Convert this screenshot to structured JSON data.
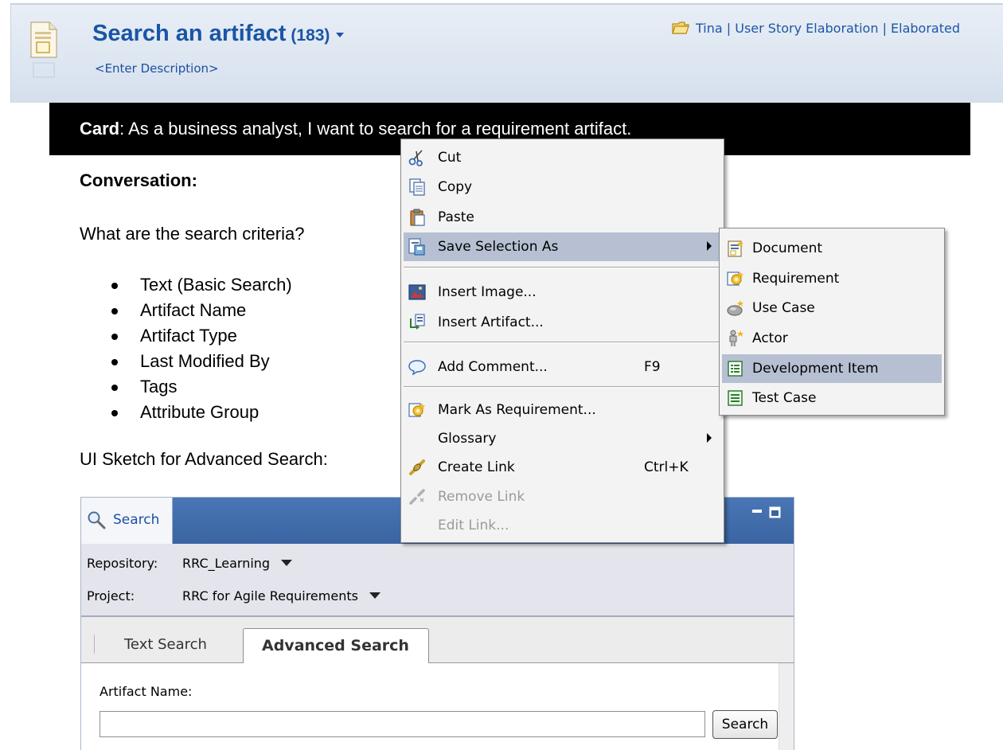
{
  "header": {
    "title": "Search an artifact",
    "count": "(183)",
    "description": "<Enter Description>",
    "context": "Tina | User Story Elaboration | Elaborated"
  },
  "card": {
    "label": "Card",
    "text": ": As a business analyst, I want to search for a requirement artifact."
  },
  "conversation": {
    "heading": "Conversation:",
    "question": "What are the search criteria?",
    "bullets": [
      "Text (Basic Search)",
      "Artifact Name",
      "Artifact Type",
      "Last Modified By",
      "Tags",
      "Attribute Group"
    ],
    "sketch_label": "UI Sketch for Advanced Search:"
  },
  "search_panel": {
    "tab_label": "Search",
    "repository_label": "Repository:",
    "repository_value": "RRC_Learning",
    "project_label": "Project:",
    "project_value": "RRC for Agile Requirements",
    "tabs": [
      "Text Search",
      "Advanced Search"
    ],
    "active_tab": "Advanced Search",
    "field_label": "Artifact Name:",
    "field_value": "",
    "search_button": "Search"
  },
  "context_menu": {
    "items": [
      {
        "label": "Cut",
        "icon": "scissors-icon"
      },
      {
        "label": "Copy",
        "icon": "copy-icon"
      },
      {
        "label": "Paste",
        "icon": "paste-icon"
      },
      {
        "label": "Save Selection As",
        "icon": "save-selection-icon",
        "submenu": true,
        "highlighted": true
      },
      {
        "label": "Insert Image...",
        "icon": "image-icon"
      },
      {
        "label": "Insert Artifact...",
        "icon": "insert-artifact-icon"
      },
      {
        "label": "Add Comment...",
        "icon": "comment-icon",
        "shortcut": "F9"
      },
      {
        "label": "Mark As Requirement...",
        "icon": "requirement-icon"
      },
      {
        "label": "Glossary",
        "submenu": true
      },
      {
        "label": "Create Link",
        "icon": "link-icon",
        "shortcut": "Ctrl+K"
      },
      {
        "label": "Remove Link",
        "icon": "remove-link-icon",
        "disabled": true
      },
      {
        "label": "Edit Link...",
        "disabled": true
      }
    ]
  },
  "submenu": {
    "items": [
      {
        "label": "Document",
        "icon": "document-icon"
      },
      {
        "label": "Requirement",
        "icon": "requirement-icon"
      },
      {
        "label": "Use Case",
        "icon": "use-case-icon"
      },
      {
        "label": "Actor",
        "icon": "actor-icon"
      },
      {
        "label": "Development Item",
        "icon": "development-item-icon",
        "highlighted": true
      },
      {
        "label": "Test Case",
        "icon": "test-case-icon"
      }
    ]
  },
  "colors": {
    "title_blue": "#1a55a4",
    "menu_highlight": "#b6c0d2",
    "card_background": "#000000",
    "panel_header_blue": "#3a64a2"
  }
}
